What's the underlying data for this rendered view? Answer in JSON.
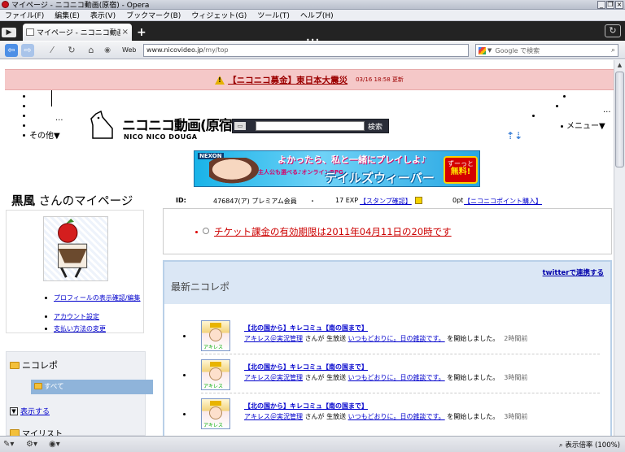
{
  "window": {
    "title": "マイページ - ニコニコ動画(原宿) - Opera",
    "controls": [
      "_",
      "❐",
      "×"
    ]
  },
  "menu": [
    "ファイル(F)",
    "編集(E)",
    "表示(V)",
    "ブックマーク(B)",
    "ウィジェット(G)",
    "ツール(T)",
    "ヘルプ(H)"
  ],
  "tabs": {
    "active_label": "マイページ - ニコニコ動画(...",
    "close": "×",
    "new_tab": "+"
  },
  "nav": {
    "web_label": "Web",
    "url_host": "www.nicovideo.jp",
    "url_path": "/my/top",
    "search_placeholder": "Google で検索"
  },
  "alert": {
    "text": "【ニコニコ募金】東日本大震災",
    "date": "03/16 18:58 更新"
  },
  "header": {
    "other_label": "その他▼",
    "menu_label": "メニュー▼",
    "logo_main": "ニコニコ動画(原宿)",
    "logo_sub": "NICO NICO DOUGA",
    "search_button": "検索"
  },
  "banner": {
    "maker": "NEXON",
    "catch": "よかったら、私と一緒にプレイしよ♪",
    "sub": "主人公も選べる♪オンラインRPG",
    "game": "テイルズウィーバー",
    "free_top": "ずーっと",
    "free_main": "無料!"
  },
  "profile": {
    "username": "黒風",
    "title_suffix": " さんのマイページ",
    "links": [
      "プロフィールの表示確認/編集",
      "アカウント設定",
      "支払い方法の変更"
    ]
  },
  "info": {
    "id_label": "ID:",
    "id_value": "476847(ア) プレミアム会員",
    "sep": "・",
    "exp": "17 EXP",
    "stamp_link": "【スタンプ確認】",
    "points": "0pt",
    "points_link": "【ニコニコポイント購入】"
  },
  "ticket": {
    "text": "チケット課金の有効期限は2011年04月11日の20時です"
  },
  "nicorepo": {
    "title": "最新ニコレポ",
    "twitter": "twitterで連携する",
    "items": [
      {
        "program": "【北の国から】キレコミュ【南の国まで】",
        "user": "アキレス＠実況管理",
        "action_pre": " さんが 生放送 ",
        "stream": "いつもどおりに。日の雑談です。",
        "action_post": " を開始しました。",
        "time": "2時間前",
        "thumb_label": "アキレス"
      },
      {
        "program": "【北の国から】キレコミュ【南の国まで】",
        "user": "アキレス＠実況管理",
        "action_pre": " さんが 生放送 ",
        "stream": "いつもどおりに。日の雑談です。",
        "action_post": " を開始しました。",
        "time": "3時間前",
        "thumb_label": "アキレス"
      },
      {
        "program": "【北の国から】キレコミュ【南の国まで】",
        "user": "アキレス＠実況管理",
        "action_pre": " さんが 生放送 ",
        "stream": "いつもどおりに。日の雑談です。",
        "action_post": " を開始しました。",
        "time": "3時間前",
        "thumb_label": "アキレス"
      }
    ]
  },
  "sidebar": {
    "nicorepo_header": "ニコレポ",
    "all": "すべて",
    "show": "表示する",
    "mylist": "マイリスト"
  },
  "status": {
    "zoom": "表示倍率 (100%)"
  }
}
